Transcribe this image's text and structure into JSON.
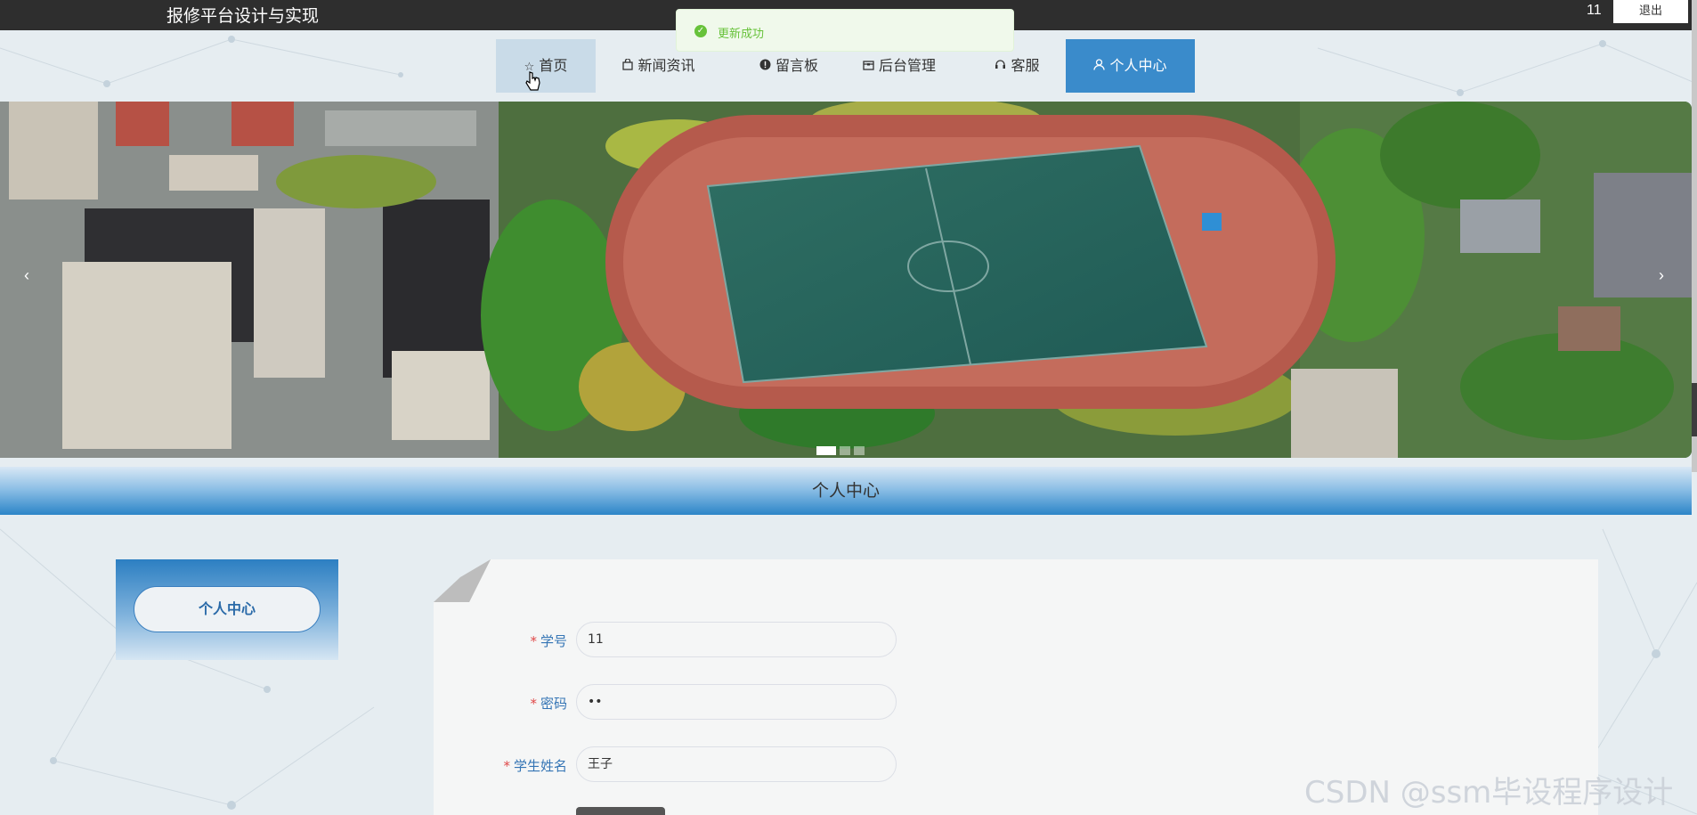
{
  "header": {
    "site_title": "报修平台设计与实现",
    "username": "11",
    "logout_label": "退出"
  },
  "toast": {
    "message": "更新成功"
  },
  "nav": {
    "items": [
      {
        "label": "首页",
        "icon": "star-icon"
      },
      {
        "label": "新闻资讯",
        "icon": "bag-icon"
      },
      {
        "label": "留言板",
        "icon": "exclamation-circle-icon"
      },
      {
        "label": "后台管理",
        "icon": "box-icon"
      },
      {
        "label": "客服",
        "icon": "headset-icon"
      },
      {
        "label": "个人中心",
        "icon": "user-icon"
      }
    ],
    "active_index": 5,
    "hover_index": 0
  },
  "banner": {
    "slide_count": 3,
    "active_slide": 1,
    "prev_glyph": "‹",
    "next_glyph": "›"
  },
  "section": {
    "title": "个人中心"
  },
  "sidebar": {
    "item_label": "个人中心"
  },
  "form": {
    "fields": [
      {
        "label": "学号",
        "value": "11",
        "required": true
      },
      {
        "label": "密码",
        "value": "••",
        "required": true
      },
      {
        "label": "学生姓名",
        "value": "王子",
        "required": true
      }
    ]
  },
  "watermark": "CSDN @ssm毕设程序设计",
  "colors": {
    "topbar": "#2e2e2e",
    "accent": "#3a8bcb",
    "success": "#67c23a",
    "required": "#e04848",
    "label": "#3575b5"
  }
}
